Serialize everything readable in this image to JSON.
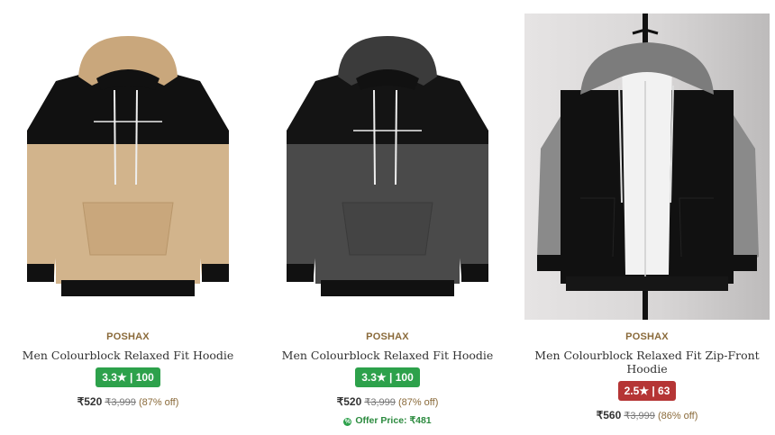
{
  "products": [
    {
      "brand": "POSHAX",
      "title": "Men Colourblock Relaxed Fit Hoodie",
      "rating": "3.3★ | 100",
      "rating_color": "#2da14b",
      "price": "₹520",
      "mrp": "₹3,999",
      "discount": "(87% off)",
      "colors": {
        "body": "#d2b48c",
        "block": "#111111"
      }
    },
    {
      "brand": "POSHAX",
      "title": "Men Colourblock Relaxed Fit Hoodie",
      "rating": "3.3★ | 100",
      "rating_color": "#2da14b",
      "price": "₹520",
      "mrp": "₹3,999",
      "discount": "(87% off)",
      "offer": "Offer Price: ₹481",
      "colors": {
        "body": "#4a4a4a",
        "block": "#111111"
      }
    },
    {
      "brand": "POSHAX",
      "title": "Men Colourblock Relaxed Fit Zip-Front Hoodie",
      "rating": "2.5★ | 63",
      "rating_color": "#b53535",
      "price": "₹560",
      "mrp": "₹3,999",
      "discount": "(86% off)",
      "colors": {
        "body": "#111111",
        "sleeves": "#8a8a8a"
      }
    }
  ],
  "icons": {
    "offer": "offer-tag-icon"
  }
}
